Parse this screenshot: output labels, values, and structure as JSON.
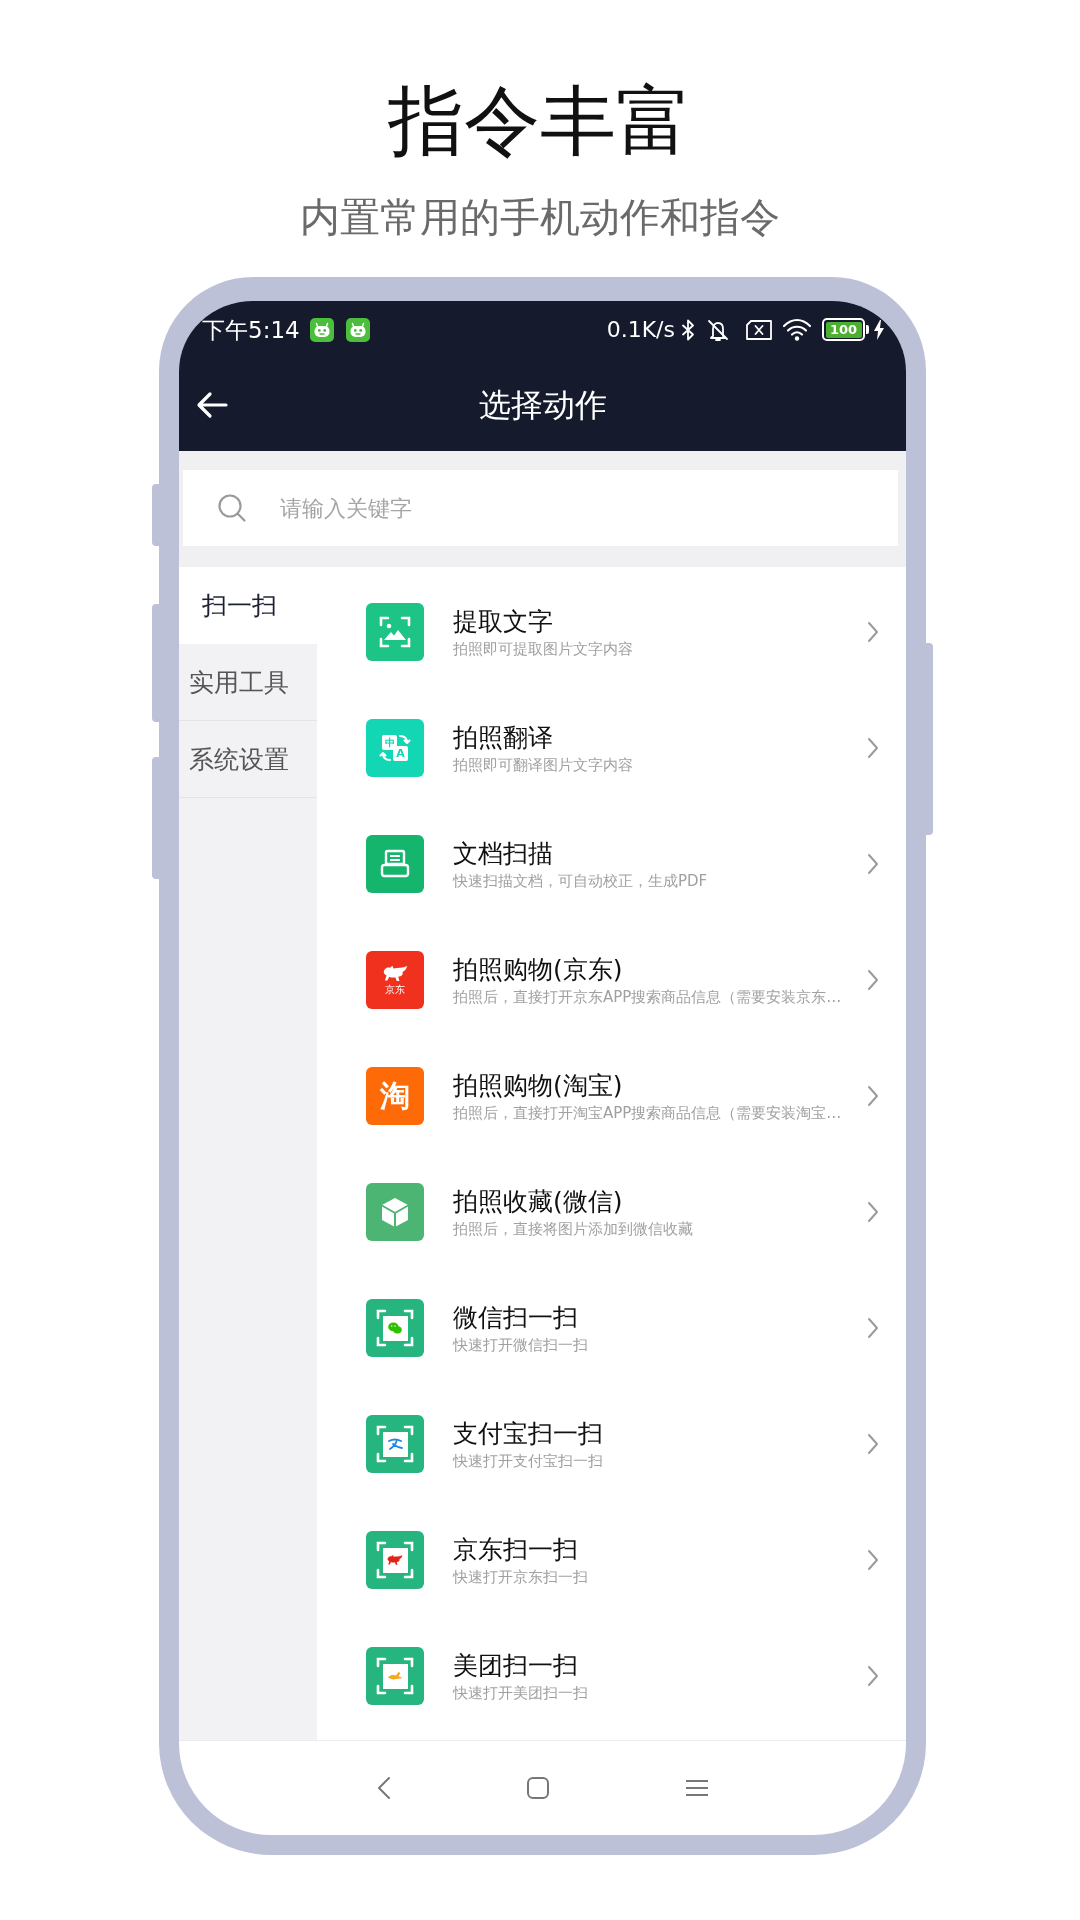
{
  "header": {
    "headline": "指令丰富",
    "subheadline": "内置常用的手机动作和指令"
  },
  "status_bar": {
    "time": "下午5:14",
    "net_speed": "0.1K/s",
    "battery": "100"
  },
  "app_bar": {
    "title": "选择动作"
  },
  "search": {
    "placeholder": "请输入关键字"
  },
  "sidebar": {
    "items": [
      {
        "label": "扫一扫",
        "selected": true
      },
      {
        "label": "实用工具",
        "selected": false
      },
      {
        "label": "系统设置",
        "selected": false
      }
    ]
  },
  "actions": [
    {
      "kind": "image-scan",
      "color": "#1ec386",
      "title": "提取文字",
      "subtitle": "拍照即可提取图片文字内容"
    },
    {
      "kind": "translate",
      "color": "#12d6b4",
      "icon_labels": [
        "中",
        "A"
      ],
      "title": "拍照翻译",
      "subtitle": "拍照即可翻译图片文字内容"
    },
    {
      "kind": "scanner",
      "color": "#15b56e",
      "title": "文档扫描",
      "subtitle": "快速扫描文档，可自动校正，生成PDF"
    },
    {
      "kind": "dog-logo",
      "color": "#f0311d",
      "icon_labels": [
        "京东"
      ],
      "title": "拍照购物(京东)",
      "subtitle": "拍照后，直接打开京东APP搜索商品信息（需要安装京东…"
    },
    {
      "kind": "letter-logo",
      "color": "#ff6a08",
      "icon_labels": [
        "淘"
      ],
      "title": "拍照购物(淘宝)",
      "subtitle": "拍照后，直接打开淘宝APP搜索商品信息（需要安装淘宝…"
    },
    {
      "kind": "cube",
      "color": "#4db574",
      "title": "拍照收藏(微信)",
      "subtitle": "拍照后，直接将图片添加到微信收藏"
    },
    {
      "kind": "scan-chat",
      "color": "#27b57f",
      "title": "微信扫一扫",
      "subtitle": "快速打开微信扫一扫"
    },
    {
      "kind": "scan-pay",
      "color": "#27b57f",
      "title": "支付宝扫一扫",
      "subtitle": "快速打开支付宝扫一扫"
    },
    {
      "kind": "scan-dog",
      "color": "#27b57f",
      "title": "京东扫一扫",
      "subtitle": "快速打开京东扫一扫"
    },
    {
      "kind": "scan-kangaroo",
      "color": "#27b57f",
      "title": "美团扫一扫",
      "subtitle": "快速打开美团扫一扫"
    }
  ]
}
